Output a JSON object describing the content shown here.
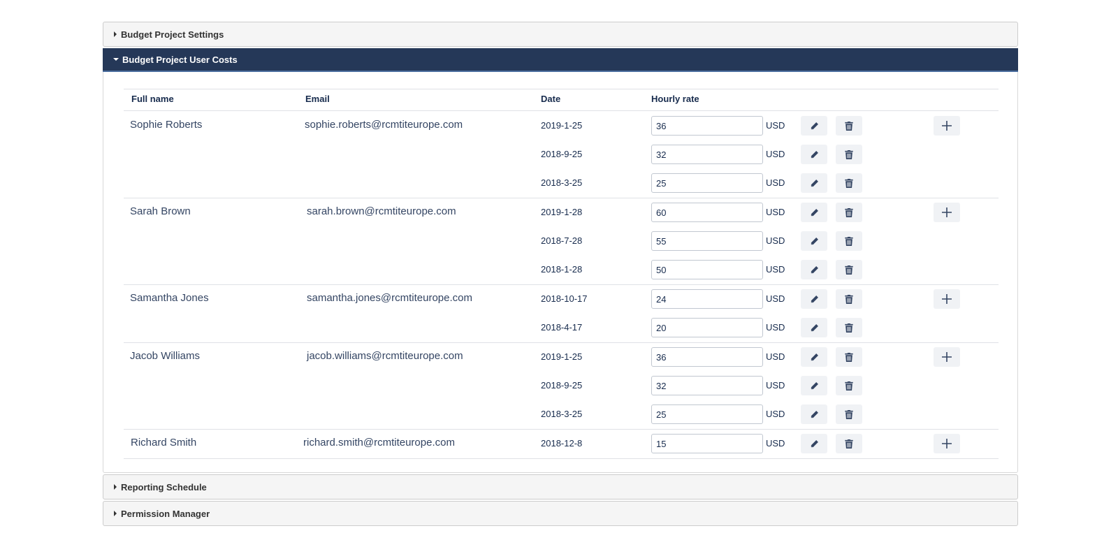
{
  "panels": {
    "settings": "Budget Project Settings",
    "costs": "Budget Project User Costs",
    "reporting": "Reporting Schedule",
    "permission": "Permission Manager"
  },
  "table": {
    "headers": {
      "name": "Full name",
      "email": "Email",
      "date": "Date",
      "rate": "Hourly rate"
    },
    "users": [
      {
        "name": "Sophie Roberts",
        "email": "sophie.roberts@rcmtiteurope.com",
        "rates": [
          {
            "date": "2019-1-25",
            "rate": "36",
            "currency": "USD"
          },
          {
            "date": "2018-9-25",
            "rate": "32",
            "currency": "USD"
          },
          {
            "date": "2018-3-25",
            "rate": "25",
            "currency": "USD"
          }
        ]
      },
      {
        "name": "Sarah Brown",
        "email": "sarah.brown@rcmtiteurope.com",
        "rates": [
          {
            "date": "2019-1-28",
            "rate": "60",
            "currency": "USD"
          },
          {
            "date": "2018-7-28",
            "rate": "55",
            "currency": "USD"
          },
          {
            "date": "2018-1-28",
            "rate": "50",
            "currency": "USD"
          }
        ]
      },
      {
        "name": "Samantha Jones",
        "email": "samantha.jones@rcmtiteurope.com",
        "rates": [
          {
            "date": "2018-10-17",
            "rate": "24",
            "currency": "USD"
          },
          {
            "date": "2018-4-17",
            "rate": "20",
            "currency": "USD"
          }
        ]
      },
      {
        "name": "Jacob Williams",
        "email": "jacob.williams@rcmtiteurope.com",
        "rates": [
          {
            "date": "2019-1-25",
            "rate": "36",
            "currency": "USD"
          },
          {
            "date": "2018-9-25",
            "rate": "32",
            "currency": "USD"
          },
          {
            "date": "2018-3-25",
            "rate": "25",
            "currency": "USD"
          }
        ]
      },
      {
        "name": "Richard Smith",
        "email": "richard.smith@rcmtiteurope.com",
        "rates": [
          {
            "date": "2018-12-8",
            "rate": "15",
            "currency": "USD"
          }
        ]
      }
    ]
  },
  "icons": {
    "edit": "pencil-icon",
    "delete": "trash-icon",
    "add": "plus-icon",
    "collapsed": "caret-right-icon",
    "expanded": "caret-down-icon"
  },
  "colors": {
    "header_bg": "#253858",
    "button_bg": "#f0f2f5",
    "icon": "#344563"
  }
}
